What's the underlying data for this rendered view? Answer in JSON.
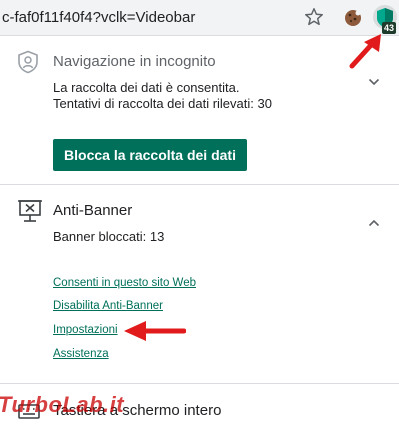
{
  "browser": {
    "url": "c-faf0f11f40f4?vclk=Videobar",
    "extension_badge": "43"
  },
  "incognito": {
    "title": "Navigazione in incognito",
    "line1": "La raccolta dei dati è consentita.",
    "line2": "Tentativi di raccolta dei dati rilevati: 30",
    "button_label": "Blocca la raccolta dei dati"
  },
  "antibanner": {
    "title": "Anti-Banner",
    "blocked_text": "Banner bloccati: 13",
    "links": [
      "Consenti in questo sito Web",
      "Disabilita Anti-Banner",
      "Impostazioni",
      "Assistenza"
    ]
  },
  "bottom": {
    "title": "Tastiera a schermo intero",
    "watermark": "TurboLab.it"
  },
  "colors": {
    "accent": "#00705a",
    "arrow": "#e11b1b"
  }
}
